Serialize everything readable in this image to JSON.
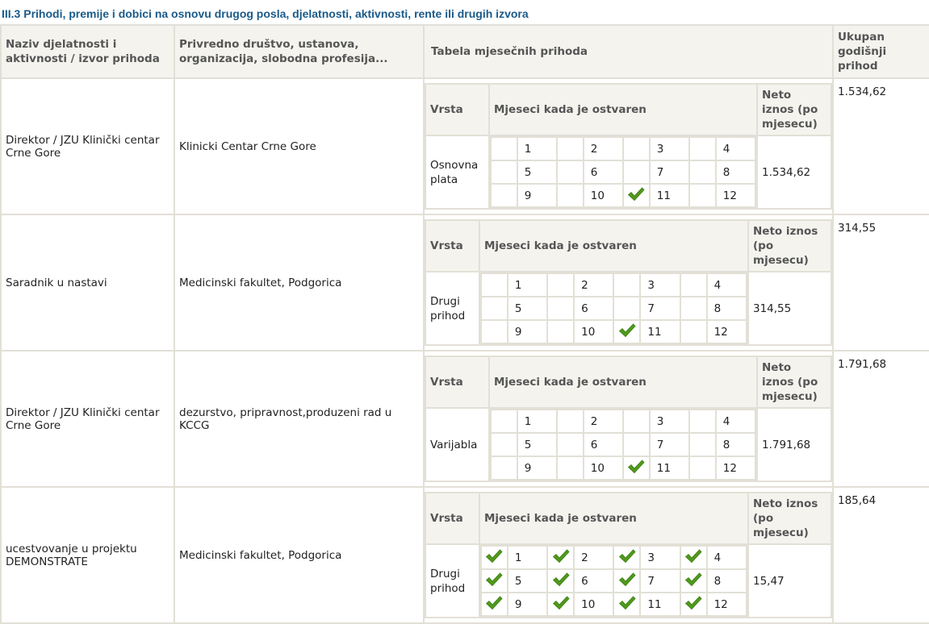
{
  "title": "III.3 Prihodi, premije i dobici na osnovu drugog posla, djelatnosti, aktivnosti, rente ili drugih izvora",
  "headers": {
    "col1": "Naziv djelatnosti i aktivnosti / izvor prihoda",
    "col2": "Privredno društvo, ustanova, organizacija, slobodna profesija...",
    "col3": "Tabela mjesečnih prihoda",
    "col4": "Ukupan godišnji prihod"
  },
  "inner_headers": {
    "vrsta": "Vrsta",
    "mjeseci": "Mjeseci kada je ostvaren",
    "neto": "Neto iznos (po mjesecu)"
  },
  "rows": [
    {
      "activity": "Direktor / JZU Klinički centar Crne Gore",
      "company": "Klinicki Centar Crne Gore",
      "vrsta": "Osnovna plata",
      "months": [
        "1",
        "2",
        "3",
        "4",
        "5",
        "6",
        "7",
        "8",
        "9",
        "10",
        "11",
        "12"
      ],
      "checked": [
        11
      ],
      "neto": "1.534,62",
      "total": "1.534,62"
    },
    {
      "activity": "Saradnik u nastavi",
      "company": "Medicinski fakultet, Podgorica",
      "vrsta": "Drugi prihod",
      "months": [
        "1",
        "2",
        "3",
        "4",
        "5",
        "6",
        "7",
        "8",
        "9",
        "10",
        "11",
        "12"
      ],
      "checked": [
        11
      ],
      "neto": "314,55",
      "total": "314,55"
    },
    {
      "activity": "Direktor / JZU Klinički centar Crne Gore",
      "company": "dezurstvo, pripravnost,produzeni rad u KCCG",
      "vrsta": "Varijabla",
      "months": [
        "1",
        "2",
        "3",
        "4",
        "5",
        "6",
        "7",
        "8",
        "9",
        "10",
        "11",
        "12"
      ],
      "checked": [
        11
      ],
      "neto": "1.791,68",
      "total": "1.791,68"
    },
    {
      "activity": "ucestvovanje u projektu DEMONSTRATE",
      "company": "Medicinski fakultet, Podgorica",
      "vrsta": "Drugi prihod",
      "months": [
        "1",
        "2",
        "3",
        "4",
        "5",
        "6",
        "7",
        "8",
        "9",
        "10",
        "11",
        "12"
      ],
      "checked": [
        1,
        2,
        3,
        4,
        5,
        6,
        7,
        8,
        9,
        10,
        11,
        12
      ],
      "neto": "15,47",
      "total": "185,64"
    }
  ],
  "colors": {
    "title": "#1a5a8a",
    "header_bg": "#f4f3ee",
    "border": "#e2e0d6",
    "check": "#4f9a1c"
  },
  "icons": {
    "check": "checkmark-icon"
  }
}
